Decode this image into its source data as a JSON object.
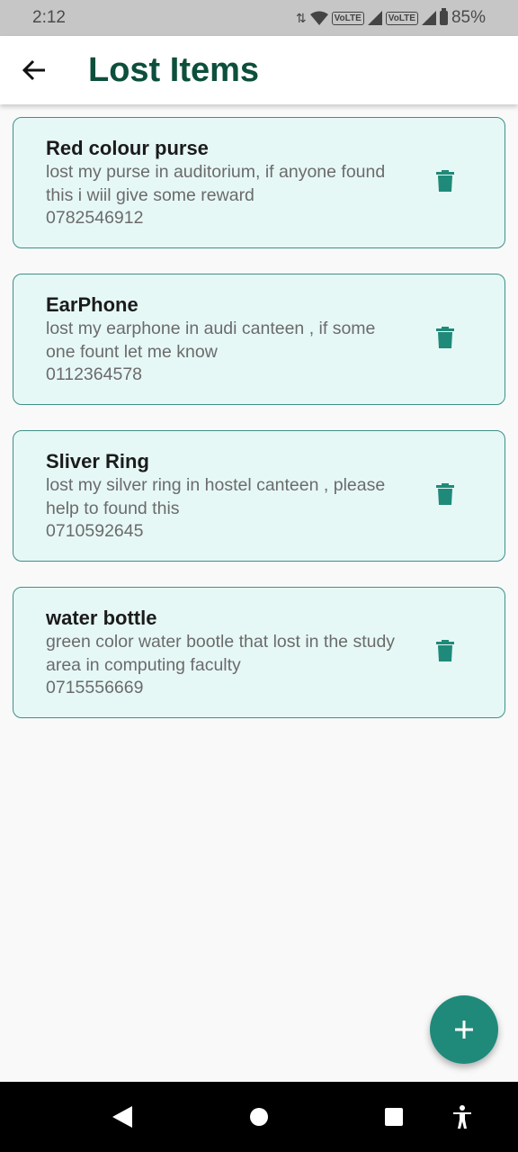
{
  "status_bar": {
    "time": "2:12",
    "volte_1": "VoLTE",
    "volte_2": "VoLTE",
    "battery": "85%"
  },
  "app_bar": {
    "title": "Lost Items",
    "back_icon": "arrow-back-icon"
  },
  "items": [
    {
      "title": "Red colour purse",
      "description": "lost my purse in auditorium, if anyone found this i wiil give some reward",
      "phone": "0782546912"
    },
    {
      "title": "EarPhone",
      "description": "lost my earphone in audi canteen , if some one fount let me know",
      "phone": "0112364578"
    },
    {
      "title": "Sliver Ring",
      "description": "lost my silver ring in hostel canteen , please help to found this",
      "phone": "0710592645"
    },
    {
      "title": "water bottle",
      "description": "green color water bootle that lost in the study area in computing faculty",
      "phone": "0715556669"
    }
  ],
  "fab": {
    "icon": "plus-icon"
  },
  "colors": {
    "primary": "#1f8a7a",
    "title": "#0d4f3c",
    "card_bg": "#e6f8f6",
    "card_border": "#3e9089"
  }
}
